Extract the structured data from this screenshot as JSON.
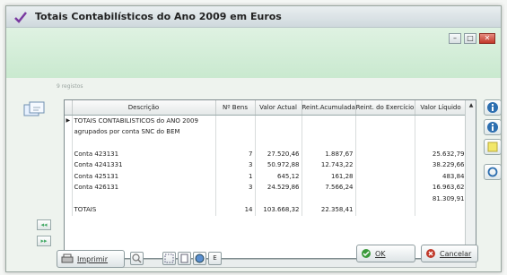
{
  "window": {
    "title": "Totais Contabilísticos do Ano 2009 em Euros",
    "records_label": "9 registos",
    "min_glyph": "–",
    "max_glyph": "□",
    "close_glyph": "✕"
  },
  "grid": {
    "columns": [
      "Descrição",
      "Nº Bens",
      "Valor Actual",
      "Reint.Acumuladas",
      "Reint. do Exercício",
      "Valor Líquido"
    ],
    "rows": [
      {
        "indicator": "",
        "desc": "TOTAIS CONTABILISTICOS do ANO 2009",
        "bens": "",
        "actual": "",
        "acum": "",
        "exerc": "",
        "liquido": ""
      },
      {
        "indicator": "",
        "desc": "agrupados por conta SNC do BEM",
        "bens": "",
        "actual": "",
        "acum": "",
        "exerc": "",
        "liquido": ""
      },
      {
        "indicator": "",
        "desc": "",
        "bens": "",
        "actual": "",
        "acum": "",
        "exerc": "",
        "liquido": ""
      },
      {
        "indicator": "",
        "desc": "Conta 423131",
        "bens": "7",
        "actual": "27.520,46",
        "acum": "1.887,67",
        "exerc": "",
        "liquido": "25.632,79"
      },
      {
        "indicator": "",
        "desc": "Conta 4241331",
        "bens": "3",
        "actual": "50.972,88",
        "acum": "12.743,22",
        "exerc": "",
        "liquido": "38.229,66"
      },
      {
        "indicator": "",
        "desc": "Conta 425131",
        "bens": "1",
        "actual": "645,12",
        "acum": "161,28",
        "exerc": "",
        "liquido": "483,84"
      },
      {
        "indicator": "",
        "desc": "Conta 426131",
        "bens": "3",
        "actual": "24.529,86",
        "acum": "7.566,24",
        "exerc": "",
        "liquido": "16.963,62"
      },
      {
        "indicator": "",
        "desc": "",
        "bens": "",
        "actual": "",
        "acum": "",
        "exerc": "",
        "liquido": "81.309,91"
      },
      {
        "indicator": "",
        "desc": "TOTAIS",
        "bens": "14",
        "actual": "103.668,32",
        "acum": "22.358,41",
        "exerc": "",
        "liquido": ""
      }
    ]
  },
  "buttons": {
    "print": "Imprimir",
    "ok": "OK",
    "cancel": "Cancelar",
    "small_e": "E"
  },
  "colors": {
    "accent_green": "#c9e9cf",
    "ok_icon": "#3a9a3a",
    "cancel_icon": "#c0392b"
  }
}
